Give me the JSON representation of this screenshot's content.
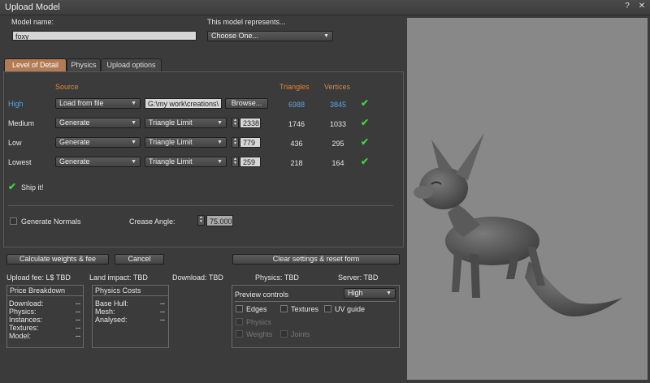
{
  "window": {
    "title": "Upload Model",
    "help_icon": "?",
    "close_icon": "✕"
  },
  "model": {
    "name_label": "Model name:",
    "name_value": "foxy",
    "represents_label": "This model represents...",
    "represents_value": "Choose One..."
  },
  "tabs": [
    {
      "label": "Level of Detail"
    },
    {
      "label": "Physics"
    },
    {
      "label": "Upload options"
    }
  ],
  "lod": {
    "source_header": "Source",
    "triangles_header": "Triangles",
    "vertices_header": "Vertices",
    "rows": [
      {
        "name": "High",
        "source": "Load from file",
        "path": "G:\\my work\\creations\\",
        "browse": "Browse...",
        "triangles": "6988",
        "vertices": "3845"
      },
      {
        "name": "Medium",
        "source": "Generate",
        "method": "Triangle Limit",
        "limit": "2338",
        "triangles": "1746",
        "vertices": "1033"
      },
      {
        "name": "Low",
        "source": "Generate",
        "method": "Triangle Limit",
        "limit": "779",
        "triangles": "436",
        "vertices": "295"
      },
      {
        "name": "Lowest",
        "source": "Generate",
        "method": "Triangle Limit",
        "limit": "259",
        "triangles": "218",
        "vertices": "164"
      }
    ],
    "ship_it": "Ship it!",
    "generate_normals": "Generate Normals",
    "crease_angle_label": "Crease Angle:",
    "crease_angle_value": "75.000"
  },
  "actions": {
    "calculate": "Calculate weights & fee",
    "cancel": "Cancel",
    "clear": "Clear settings & reset form"
  },
  "stats": {
    "upload_fee": "Upload fee: L$ TBD",
    "land_impact": "Land impact: TBD",
    "download": "Download: TBD",
    "physics": "Physics: TBD",
    "server": "Server: TBD"
  },
  "price_breakdown": {
    "title": "Price Breakdown",
    "rows": [
      {
        "k": "Download:",
        "v": "--"
      },
      {
        "k": "Physics:",
        "v": "--"
      },
      {
        "k": "Instances:",
        "v": "--"
      },
      {
        "k": "Textures:",
        "v": "--"
      },
      {
        "k": "Model:",
        "v": "--"
      }
    ]
  },
  "physics_costs": {
    "title": "Physics Costs",
    "rows": [
      {
        "k": "Base Hull:",
        "v": "--"
      },
      {
        "k": "Mesh:",
        "v": "--"
      },
      {
        "k": "Analysed:",
        "v": "--"
      }
    ]
  },
  "preview_controls": {
    "title": "Preview controls",
    "level": "High",
    "edges": "Edges",
    "textures": "Textures",
    "uv_guide": "UV guide",
    "physics": "Physics",
    "weights": "Weights",
    "joints": "Joints"
  }
}
